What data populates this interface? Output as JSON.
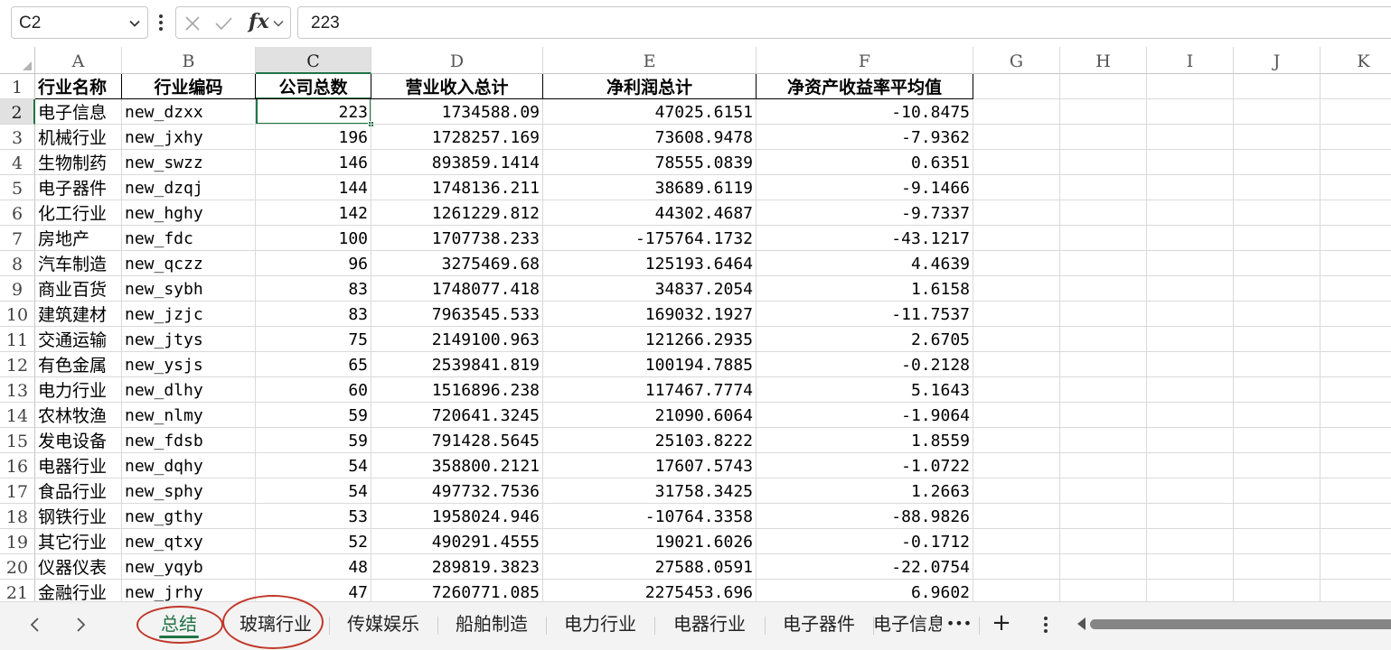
{
  "formula_bar": {
    "name_box": "C2",
    "fx_label": "fx",
    "formula_value": "223"
  },
  "columns": [
    "A",
    "B",
    "C",
    "D",
    "E",
    "F",
    "G",
    "H",
    "I",
    "J",
    "K"
  ],
  "selected_column": "C",
  "selected_row": "2",
  "header_row": {
    "row_number": "1",
    "cells": [
      "行业名称",
      "行业编码",
      "公司总数",
      "营业收入总计",
      "净利润总计",
      "净资产收益率平均值"
    ]
  },
  "rows": [
    {
      "n": "2",
      "name": "电子信息",
      "code": "new_dzxx",
      "count": "223",
      "revenue": "1734588.09",
      "profit": "47025.6151",
      "roe": "-10.8475"
    },
    {
      "n": "3",
      "name": "机械行业",
      "code": "new_jxhy",
      "count": "196",
      "revenue": "1728257.169",
      "profit": "73608.9478",
      "roe": "-7.9362"
    },
    {
      "n": "4",
      "name": "生物制药",
      "code": "new_swzz",
      "count": "146",
      "revenue": "893859.1414",
      "profit": "78555.0839",
      "roe": "0.6351"
    },
    {
      "n": "5",
      "name": "电子器件",
      "code": "new_dzqj",
      "count": "144",
      "revenue": "1748136.211",
      "profit": "38689.6119",
      "roe": "-9.1466"
    },
    {
      "n": "6",
      "name": "化工行业",
      "code": "new_hghy",
      "count": "142",
      "revenue": "1261229.812",
      "profit": "44302.4687",
      "roe": "-9.7337"
    },
    {
      "n": "7",
      "name": "房地产",
      "code": "new_fdc",
      "count": "100",
      "revenue": "1707738.233",
      "profit": "-175764.1732",
      "roe": "-43.1217"
    },
    {
      "n": "8",
      "name": "汽车制造",
      "code": "new_qczz",
      "count": "96",
      "revenue": "3275469.68",
      "profit": "125193.6464",
      "roe": "4.4639"
    },
    {
      "n": "9",
      "name": "商业百货",
      "code": "new_sybh",
      "count": "83",
      "revenue": "1748077.418",
      "profit": "34837.2054",
      "roe": "1.6158"
    },
    {
      "n": "10",
      "name": "建筑建材",
      "code": "new_jzjc",
      "count": "83",
      "revenue": "7963545.533",
      "profit": "169032.1927",
      "roe": "-11.7537"
    },
    {
      "n": "11",
      "name": "交通运输",
      "code": "new_jtys",
      "count": "75",
      "revenue": "2149100.963",
      "profit": "121266.2935",
      "roe": "2.6705"
    },
    {
      "n": "12",
      "name": "有色金属",
      "code": "new_ysjs",
      "count": "65",
      "revenue": "2539841.819",
      "profit": "100194.7885",
      "roe": "-0.2128"
    },
    {
      "n": "13",
      "name": "电力行业",
      "code": "new_dlhy",
      "count": "60",
      "revenue": "1516896.238",
      "profit": "117467.7774",
      "roe": "5.1643"
    },
    {
      "n": "14",
      "name": "农林牧渔",
      "code": "new_nlmy",
      "count": "59",
      "revenue": "720641.3245",
      "profit": "21090.6064",
      "roe": "-1.9064"
    },
    {
      "n": "15",
      "name": "发电设备",
      "code": "new_fdsb",
      "count": "59",
      "revenue": "791428.5645",
      "profit": "25103.8222",
      "roe": "1.8559"
    },
    {
      "n": "16",
      "name": "电器行业",
      "code": "new_dqhy",
      "count": "54",
      "revenue": "358800.2121",
      "profit": "17607.5743",
      "roe": "-1.0722"
    },
    {
      "n": "17",
      "name": "食品行业",
      "code": "new_sphy",
      "count": "54",
      "revenue": "497732.7536",
      "profit": "31758.3425",
      "roe": "1.2663"
    },
    {
      "n": "18",
      "name": "钢铁行业",
      "code": "new_gthy",
      "count": "53",
      "revenue": "1958024.946",
      "profit": "-10764.3358",
      "roe": "-88.9826"
    },
    {
      "n": "19",
      "name": "其它行业",
      "code": "new_qtxy",
      "count": "52",
      "revenue": "490291.4555",
      "profit": "19021.6026",
      "roe": "-0.1712"
    },
    {
      "n": "20",
      "name": "仪器仪表",
      "code": "new_yqyb",
      "count": "48",
      "revenue": "289819.3823",
      "profit": "27588.0591",
      "roe": "-22.0754"
    },
    {
      "n": "21",
      "name": "金融行业",
      "code": "new_jrhy",
      "count": "47",
      "revenue": "7260771.085",
      "profit": "2275453.696",
      "roe": "6.9602"
    }
  ],
  "sheet_tabs": [
    "总结",
    "玻璃行业",
    "传媒娱乐",
    "船舶制造",
    "电力行业",
    "电器行业",
    "电子器件",
    "电子信息"
  ],
  "active_tab": "总结",
  "tab_more": "•••",
  "add_sheet": "+",
  "colors": {
    "accent": "#217346",
    "annotation": "#c0392b",
    "header_selected_bg": "#e1e1e1"
  }
}
